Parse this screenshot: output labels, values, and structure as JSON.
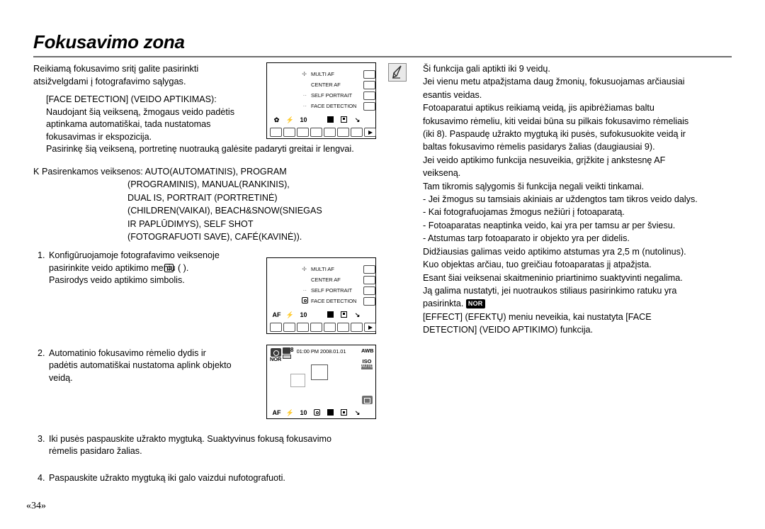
{
  "header": {
    "title": "Fokusavimo zona"
  },
  "left_column": {
    "intro": [
      "Reikiamą fokusavimo sritį galite pasirinkti",
      "atsižvelgdami į fotografavimo sąlygas."
    ],
    "face_detection_heading": "[FACE DETECTION] (VEIDO APTIKIMAS):",
    "face_detection_body": [
      "Naudojant šią veikseną, žmogaus veido padėtis",
      "aptinkama automatiškai, tada nustatomas",
      "fokusavimas ir ekspozicija."
    ],
    "face_detection_note": "Pasirinkę šią veikseną, portretinę nuotrauką galėsite padaryti greitai ir lengvai.",
    "modes_marker": "K",
    "modes_label": "Pasirenkamos veiksenos: AUTO(AUTOMATINIS), PROGRAM",
    "modes_lines": [
      "(PROGRAMINIS), MANUAL(RANKINIS),",
      "DUAL IS, PORTRAIT (PORTRETINĖ)",
      "(CHILDREN(VAIKAI), BEACH&SNOW(SNIEGAS",
      "IR PAPLŪDIMYS), SELF SHOT",
      "(FOTOGRAFUOTI SAVE), CAFÉ(KAVINĖ))."
    ],
    "steps": [
      {
        "num": "1.",
        "lines": [
          "Konfigūruojamoje fotografavimo veiksenoje",
          "pasirinkite veido aptikimo meniu  (      ).",
          "Pasirodys veido aptikimo simbolis."
        ]
      },
      {
        "num": "2.",
        "lines": [
          "Automatinio fokusavimo rėmelio dydis ir",
          "padėtis automatiškai nustatoma aplink objekto",
          "veidą."
        ]
      },
      {
        "num": "3.",
        "lines": [
          "Iki pusės paspauskite užrakto mygtuką. Suaktyvinus fokusą fokusavimo",
          "rėmelis pasidaro žalias."
        ]
      },
      {
        "num": "4.",
        "lines": [
          "Paspauskite užrakto mygtuką iki galo vaizdui nufotografuoti."
        ]
      }
    ]
  },
  "right_column": {
    "note_icon": "pen-note-icon",
    "lines": [
      "Ši funkcija gali aptikti iki 9 veidų.",
      "Jei vienu metu atpažįstama daug žmonių, fokusuojamas arčiausiai",
      "esantis veidas.",
      "Fotoaparatui aptikus reikiamą veidą, jis apibrėžiamas baltu",
      "fokusavimo rėmeliu, kiti veidai būna su pilkais fokusavimo rėmeliais",
      "(iki 8). Paspaudę užrakto mygtuką iki pusės, sufokusuokite veidą ir",
      "baltas fokusavimo rėmelis pasidarys žalias (daugiausiai 9).",
      "Jei veido aptikimo funkcija nesuveikia, grįžkite į ankstesnę AF",
      "veikseną.",
      "Tam tikromis sąlygomis ši funkcija negali veikti tinkamai.",
      "- Jei žmogus su tamsiais akiniais ar uždengtos tam tikros veido dalys.",
      "- Kai fotografuojamas žmogus nežiūri į fotoaparatą.",
      "- Fotoaparatas neaptinka veido, kai yra per tamsu ar per šviesu.",
      "- Atstumas tarp fotoaparato ir objekto yra per didelis.",
      "Didžiausias galimas veido aptikimo atstumas yra 2,5 m (nutolinus).",
      "Kuo objektas arčiau, tuo greičiau fotoaparatas jį atpažįsta.",
      "Esant šiai veiksenai skaitmeninio priartinimo suaktyvinti negalima.",
      "Ją galima nustatyti, jei nuotraukos stiliaus pasirinkimo ratuku yra"
    ],
    "badge_line_prefix": "pasirinkta. ",
    "badge_label": "NOR",
    "tail_lines": [
      "[EFFECT] (EFEKTŲ) meniu neveikia, kai nustatyta [FACE",
      "DETECTION] (VEIDO APTIKIMO) funkcija."
    ]
  },
  "lcd_menu_1": {
    "rows": [
      {
        "icon": "crosshair-icon",
        "icon_glyph": "✢",
        "label": "MULTI AF"
      },
      {
        "icon": "none",
        "icon_glyph": "",
        "label": "CENTER AF"
      },
      {
        "icon": "dots-icon",
        "icon_glyph": "··",
        "label": "SELF PORTRAIT"
      },
      {
        "icon": "dots-icon",
        "icon_glyph": "··",
        "label": "FACE DETECTION"
      }
    ],
    "bottom_icons": [
      {
        "name": "macro-flower-icon",
        "glyph": "✿"
      },
      {
        "name": "flash-icon",
        "glyph": "⚡"
      },
      {
        "name": "timer-10s-icon",
        "glyph": "10"
      },
      {
        "name": "blank",
        "glyph": ""
      },
      {
        "name": "multi-af-filled-icon",
        "glyph": "■"
      },
      {
        "name": "center-af-icon",
        "glyph": "▣"
      },
      {
        "name": "self-portrait-icon",
        "glyph": "↘"
      }
    ],
    "cell_count": 8
  },
  "lcd_menu_2": {
    "rows": [
      {
        "icon": "crosshair-icon",
        "icon_glyph": "✢",
        "label": "MULTI AF"
      },
      {
        "icon": "none",
        "icon_glyph": "",
        "label": "CENTER AF"
      },
      {
        "icon": "dots-icon",
        "icon_glyph": "··",
        "label": "SELF PORTRAIT"
      },
      {
        "icon": "face-detection-icon",
        "icon_glyph": "☻",
        "label": "FACE DETECTION"
      }
    ],
    "bottom_icons": [
      {
        "name": "af-label-icon",
        "glyph": "AF"
      },
      {
        "name": "flash-icon",
        "glyph": "⚡"
      },
      {
        "name": "timer-10s-icon",
        "glyph": "10"
      },
      {
        "name": "blank",
        "glyph": ""
      },
      {
        "name": "multi-af-filled-icon",
        "glyph": "■"
      },
      {
        "name": "center-af-icon",
        "glyph": "▣"
      },
      {
        "name": "self-portrait-icon",
        "glyph": "↘"
      }
    ],
    "cell_count": 8
  },
  "lcd_preview": {
    "shots_remaining": "8",
    "quality": "NOR",
    "datetime": "01:00 PM 2008.01.01",
    "white_balance": "AWB",
    "iso_label": "ISO",
    "iso_value": "AUTO",
    "bottom_icons": [
      {
        "name": "af-label-icon",
        "glyph": "AF"
      },
      {
        "name": "flash-icon",
        "glyph": "⚡"
      },
      {
        "name": "timer-10s-icon",
        "glyph": "10"
      },
      {
        "name": "face-detection-icon",
        "glyph": "☻"
      },
      {
        "name": "multi-af-filled-icon",
        "glyph": "■"
      },
      {
        "name": "center-af-icon",
        "glyph": "▣"
      },
      {
        "name": "self-portrait-icon",
        "glyph": "↘"
      }
    ]
  },
  "footer": {
    "page_number": "«34»"
  },
  "colors": {
    "text": "#000000",
    "rule": "#6d6d6d",
    "lcd_border": "#000000",
    "af_frame": "#7d7d7d"
  }
}
